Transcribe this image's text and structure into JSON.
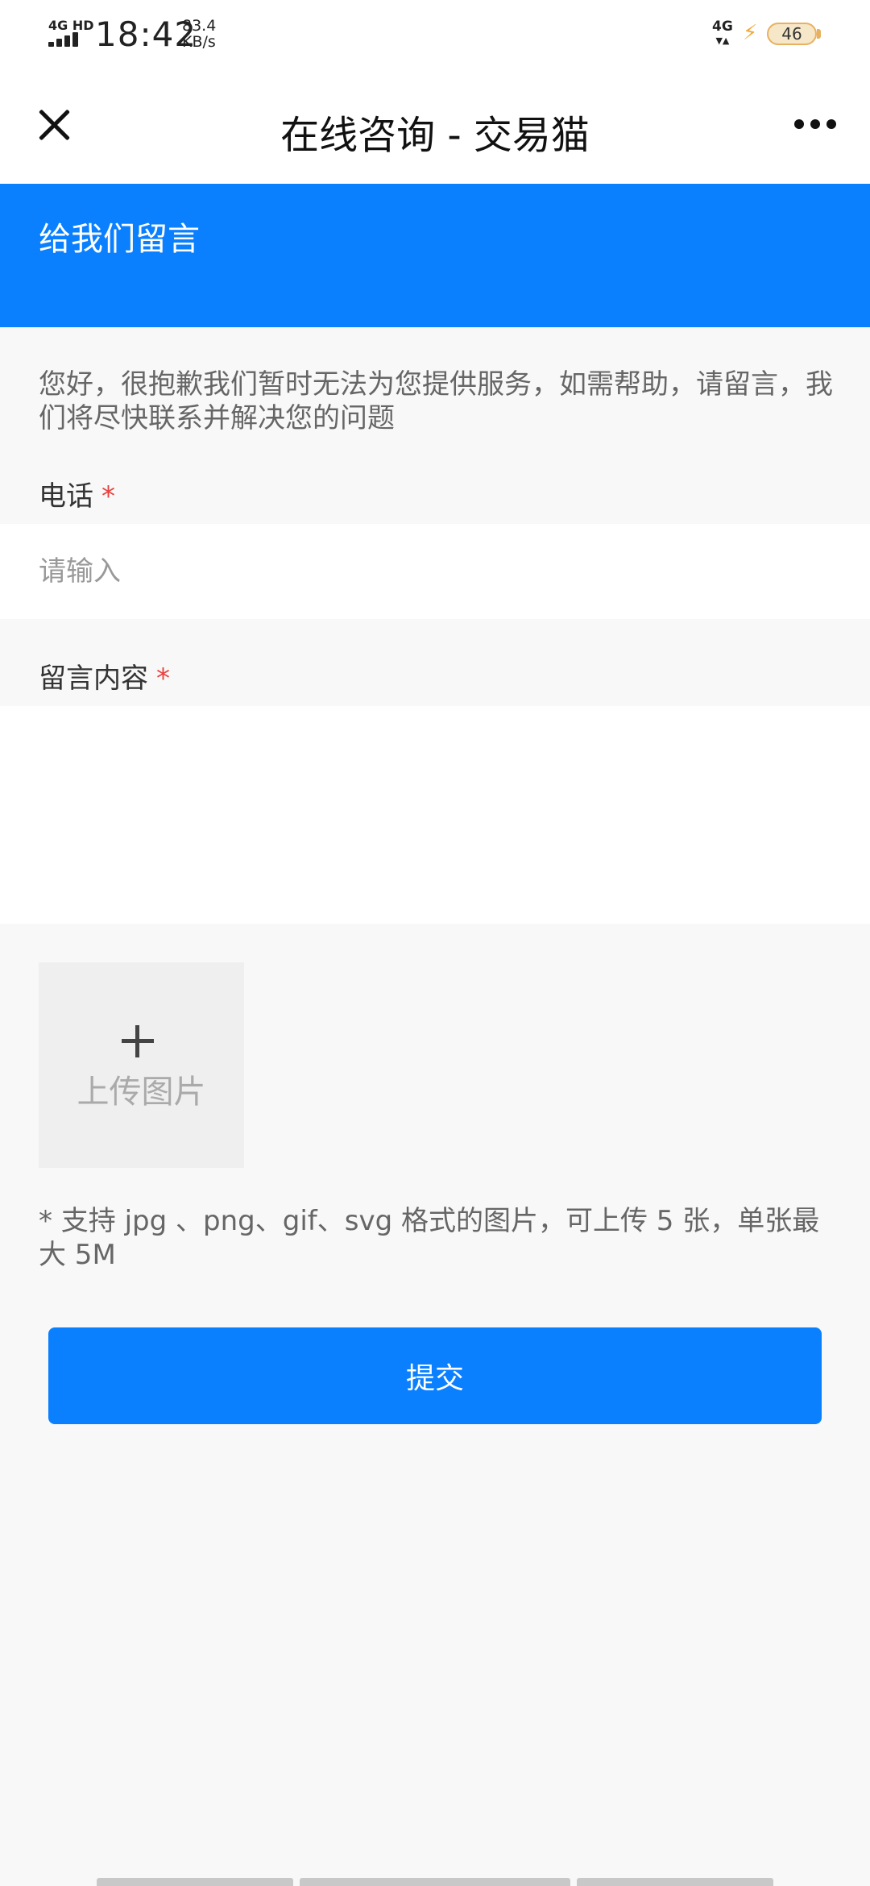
{
  "status_bar": {
    "network": "4G HD",
    "time": "18:42",
    "speed_value": "83.4",
    "speed_unit": "KB/s",
    "network_right": "4G",
    "battery": "46"
  },
  "nav": {
    "title": "在线咨询 - 交易猫"
  },
  "banner": {
    "title": "给我们留言"
  },
  "form": {
    "intro": "您好，很抱歉我们暂时无法为您提供服务，如需帮助，请留言，我们将尽快联系并解决您的问题",
    "phone_label": "电话",
    "required_mark": "*",
    "phone_placeholder": "请输入",
    "phone_value": "",
    "message_label": "留言内容",
    "message_value": "",
    "upload_label": "上传图片",
    "upload_hint": "* 支持 jpg 、png、gif、svg 格式的图片，可上传 5 张，单张最大 5M",
    "submit_label": "提交"
  },
  "colors": {
    "accent": "#0a80ff",
    "required": "#e64340",
    "background": "#f8f8f8"
  }
}
